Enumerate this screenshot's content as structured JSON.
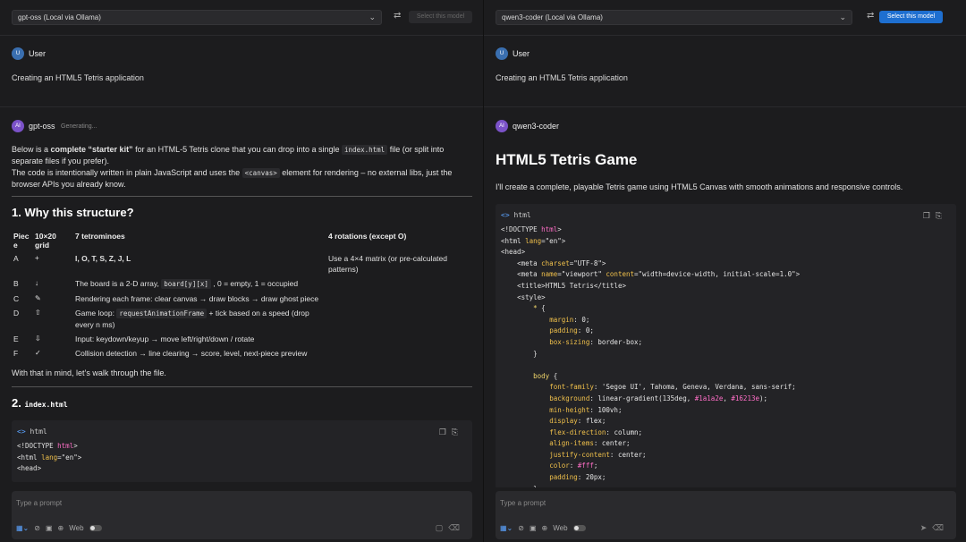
{
  "left": {
    "model": "gpt-oss (Local via Ollama)",
    "select_label": "Select this model",
    "user_label": "User",
    "user_avatar": "U",
    "prompt": "Creating an HTML5 Tetris application",
    "ai_avatar": "AI",
    "ai_name": "gpt-oss",
    "status": "Generating...",
    "intro1_a": "Below is a ",
    "intro1_b": "complete “starter kit”",
    "intro1_c": " for an HTML-5 Tetris clone that you can drop into a single ",
    "intro1_code": "index.html",
    "intro1_d": " file (or split into separate files if you prefer).",
    "intro2_a": "The code is intentionally written in plain JavaScript and uses the ",
    "intro2_code": "<canvas>",
    "intro2_b": " element for rendering – no external libs, just the browser APIs you already know.",
    "h1": "1. Why this structure?",
    "table_headers": [
      "Piec e",
      "10×20 grid",
      "7 tetrominoes",
      "4 rotations (except O)"
    ],
    "table_rows": [
      {
        "piece": "A",
        "icon": "+",
        "text": "I, O, T, S, Z, J, L",
        "extra": "Use a 4×4 matrix (or pre-calculated patterns)"
      },
      {
        "piece": "B",
        "icon": "↓",
        "text_a": "The board is a 2-D array, ",
        "code": "board[y][x]",
        "text_b": " , 0 = empty, 1 = occupied"
      },
      {
        "piece": "C",
        "icon": "✎",
        "text": "Rendering each frame: clear canvas → draw blocks → draw ghost piece"
      },
      {
        "piece": "D",
        "icon": "⇧",
        "text_a": "Game loop: ",
        "code": "requestAnimationFrame",
        "text_b": " + tick based on a speed (drop every n ms)"
      },
      {
        "piece": "E",
        "icon": "⇩",
        "text": "Input: keydown/keyup → move left/right/down / rotate"
      },
      {
        "piece": "F",
        "icon": "✓",
        "text": "Collision detection → line clearing → score, level, next-piece preview"
      }
    ],
    "outro": "With that in mind, let’s walk through the file.",
    "h2_num": "2.",
    "h2_code": "index.html",
    "code_lang": "html",
    "code_lines": [
      "<!DOCTYPE html>",
      "<html lang=\"en\">",
      "<head>"
    ],
    "input_placeholder": "Type a prompt",
    "web_label": "Web"
  },
  "right": {
    "model": "qwen3-coder (Local via Ollama)",
    "select_label": "Select this model",
    "user_label": "User",
    "user_avatar": "U",
    "prompt": "Creating an HTML5 Tetris application",
    "ai_avatar": "AI",
    "ai_name": "qwen3-coder",
    "title": "HTML5 Tetris Game",
    "intro": "I'll create a complete, playable Tetris game using HTML5 Canvas with smooth animations and responsive controls.",
    "code_lang": "html",
    "input_placeholder": "Type a prompt",
    "web_label": "Web"
  },
  "icons": {
    "chevron": "chevron-down-icon",
    "swap": "swap-icon",
    "copy": "copy-icon",
    "apply": "apply-icon"
  }
}
